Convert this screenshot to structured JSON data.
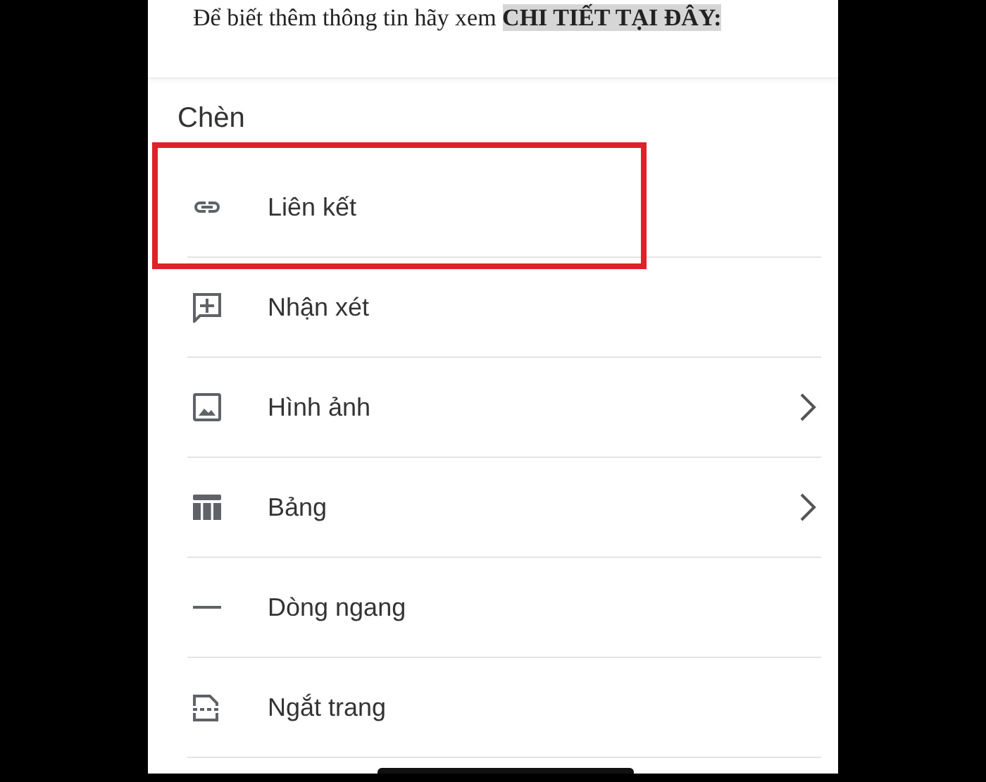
{
  "document": {
    "text": "Để biết thêm thông tin hãy xem **CHI TIẾT TẠI ĐÂY:**"
  },
  "sheet": {
    "title": "Chèn",
    "items": [
      {
        "label": "Liên kết",
        "kind": "link",
        "submenu": false,
        "highlighted": true
      },
      {
        "label": "Nhận xét",
        "kind": "comment",
        "submenu": false,
        "highlighted": false
      },
      {
        "label": "Hình ảnh",
        "kind": "image",
        "submenu": true,
        "highlighted": false
      },
      {
        "label": "Bảng",
        "kind": "table",
        "submenu": true,
        "highlighted": false
      },
      {
        "label": "Dòng ngang",
        "kind": "rule",
        "submenu": false,
        "highlighted": false
      },
      {
        "label": "Ngắt trang",
        "kind": "pagebreak",
        "submenu": false,
        "highlighted": false
      }
    ]
  }
}
